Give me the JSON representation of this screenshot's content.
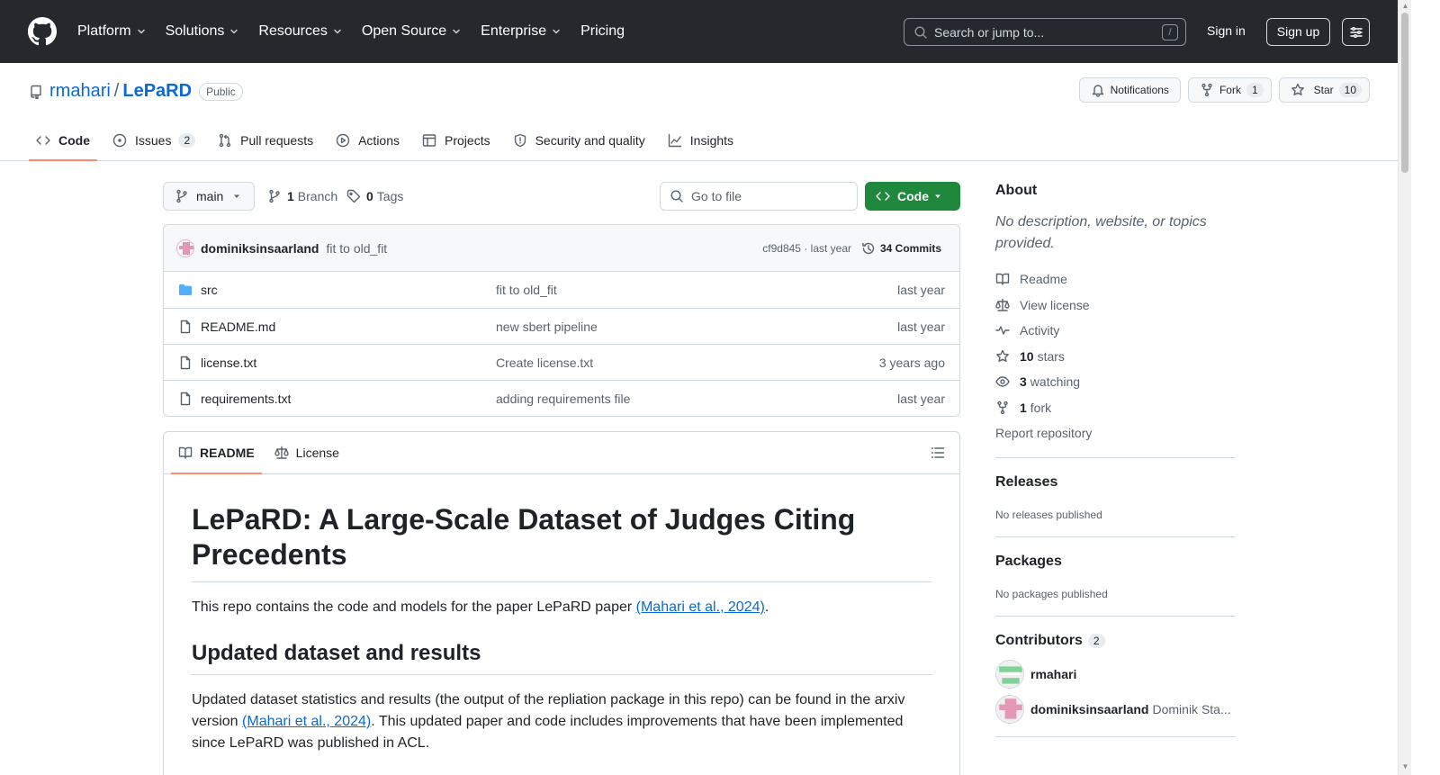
{
  "topnav": {
    "items": [
      "Platform",
      "Solutions",
      "Resources",
      "Open Source",
      "Enterprise",
      "Pricing"
    ],
    "search_placeholder": "Search or jump to...",
    "search_key": "/",
    "signin": "Sign in",
    "signup": "Sign up"
  },
  "repo": {
    "owner": "rmahari",
    "separator": "/",
    "name": "LePaRD",
    "visibility": "Public",
    "notifications_label": "Notifications",
    "fork_label": "Fork",
    "fork_count": "1",
    "star_label": "Star",
    "star_count": "10"
  },
  "tabs": [
    {
      "label": "Code",
      "count": null,
      "icon": "code-icon"
    },
    {
      "label": "Issues",
      "count": "2",
      "icon": "issue-icon"
    },
    {
      "label": "Pull requests",
      "count": null,
      "icon": "pull-request-icon"
    },
    {
      "label": "Actions",
      "count": null,
      "icon": "play-icon"
    },
    {
      "label": "Projects",
      "count": null,
      "icon": "table-icon"
    },
    {
      "label": "Security and quality",
      "count": null,
      "icon": "shield-icon"
    },
    {
      "label": "Insights",
      "count": null,
      "icon": "graph-icon"
    }
  ],
  "browser": {
    "branch": "main",
    "branch_count": "1",
    "branch_label": "Branch",
    "tag_count": "0",
    "tag_label": "Tags",
    "goto_placeholder": "Go to file",
    "code_button": "Code"
  },
  "latest_commit": {
    "author": "dominiksinsaarland",
    "message": "fit to old_fit",
    "hash_date": "cf9d845 · last year",
    "commits": "34 Commits"
  },
  "files": [
    {
      "name": "src",
      "type": "folder",
      "message": "fit to old_fit",
      "date": "last year"
    },
    {
      "name": "README.md",
      "type": "file",
      "message": "new sbert pipeline",
      "date": "last year"
    },
    {
      "name": "license.txt",
      "type": "file",
      "message": "Create license.txt",
      "date": "3 years ago"
    },
    {
      "name": "requirements.txt",
      "type": "file",
      "message": "adding requirements file",
      "date": "last year"
    }
  ],
  "readme": {
    "tab_readme": "README",
    "tab_license": "License",
    "title": "LePaRD: A Large-Scale Dataset of Judges Citing Precedents",
    "intro_pre": "This repo contains the code and models for the paper LePaRD paper ",
    "intro_link": "(Mahari et al., 2024)",
    "intro_post": ".",
    "h2": "Updated dataset and results",
    "p2_pre": "Updated dataset statistics and results (the output of the repliation package in this repo) can be found in the arxiv version ",
    "p2_link": "(Mahari et al., 2024)",
    "p2_post": ". This updated paper and code includes improvements that have been implemented since LePaRD was published in ACL."
  },
  "sidebar": {
    "about_title": "About",
    "about_desc": "No description, website, or topics provided.",
    "readme": "Readme",
    "license": "View license",
    "activity": "Activity",
    "stars_count": "10",
    "stars_label": "stars",
    "watching_count": "3",
    "watching_label": "watching",
    "forks_count": "1",
    "forks_label": "fork",
    "report": "Report repository",
    "releases_title": "Releases",
    "releases_text": "No releases published",
    "packages_title": "Packages",
    "packages_text": "No packages published",
    "contributors_title": "Contributors",
    "contributors_count": "2",
    "contributors": [
      {
        "login": "rmahari",
        "name": ""
      },
      {
        "login": "dominiksinsaarland",
        "name": "Dominik Sta..."
      }
    ]
  },
  "colors": {
    "header_bg": "#25292e",
    "link": "#0969da",
    "code_button": "#1f883d",
    "active_tab_underline": "#fd8c73"
  }
}
